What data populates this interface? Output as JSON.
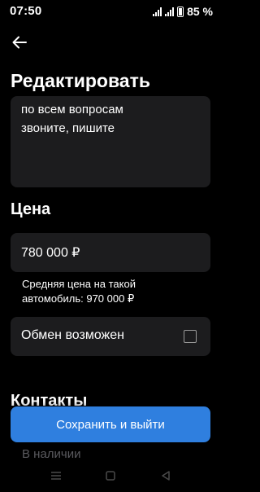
{
  "status_bar": {
    "time": "07:50",
    "battery": "85 %",
    "network": "4G"
  },
  "header": {
    "title": "Редактировать",
    "back_icon": "arrow-left-icon"
  },
  "description": {
    "text": "по всем вопросам\nзвоните, пишите"
  },
  "price": {
    "section_title": "Цена",
    "value": "780 000 ₽",
    "average_hint": "Средняя цена на такой автомобиль: 970 000 ₽"
  },
  "exchange": {
    "label": "Обмен возможен",
    "checked": false
  },
  "contacts": {
    "section_title": "Контакты"
  },
  "availability": {
    "text": "В наличии"
  },
  "actions": {
    "save_label": "Сохранить и выйти"
  },
  "colors": {
    "background": "#000000",
    "field": "#1c1c1e",
    "accent": "#2f7fdf"
  }
}
